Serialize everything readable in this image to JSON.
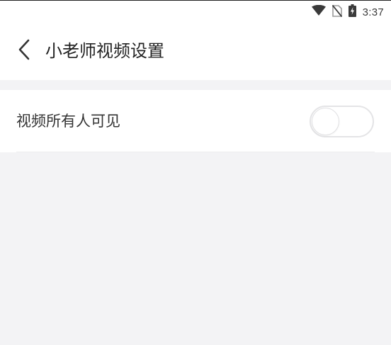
{
  "status_bar": {
    "time": "3:37",
    "icons": [
      "wifi-icon",
      "no-sim-icon",
      "battery-charging-icon"
    ]
  },
  "header": {
    "back_icon": "chevron-left-icon",
    "title": "小老师视频设置"
  },
  "settings": {
    "items": [
      {
        "label": "视频所有人可见",
        "toggle_on": false
      }
    ]
  },
  "colors": {
    "page_background": "#f3f3f5",
    "surface": "#ffffff",
    "title_text": "#222222",
    "label_text": "#333333",
    "toggle_border": "#e4e4e6"
  }
}
